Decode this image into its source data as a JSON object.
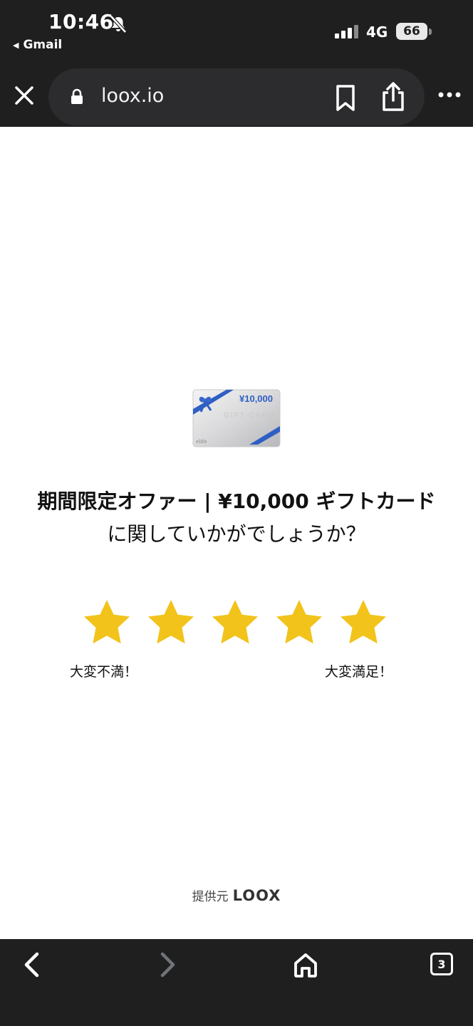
{
  "status_bar": {
    "time": "10:46",
    "back_app": "Gmail",
    "network": "4G",
    "battery": "66"
  },
  "url_bar": {
    "url": "loox.io",
    "icons": [
      "close-icon",
      "lock-icon",
      "bookmark-icon",
      "share-icon",
      "more-icon"
    ]
  },
  "content": {
    "gift_card": {
      "amount": "¥10,000",
      "text": "GIFT CARD",
      "brand": "elife"
    },
    "title": "期間限定オファー | ¥10,000 ギフトカード",
    "subtitle": "に関していかがでしょうか？",
    "rating": {
      "max": 5,
      "filled": 5,
      "star_color": "#F2C31B",
      "low_label": "大変不満！",
      "high_label": "大変満足！"
    },
    "powered_by": "提供元",
    "logo": "LOOX"
  },
  "toolbar": {
    "tab_count": "3",
    "icons": [
      "back-icon",
      "forward-icon",
      "home-icon"
    ]
  },
  "colors": {
    "chrome": "#1F1F1F",
    "pill": "#2C2C2E",
    "ribbon": "#2F5FC4"
  }
}
